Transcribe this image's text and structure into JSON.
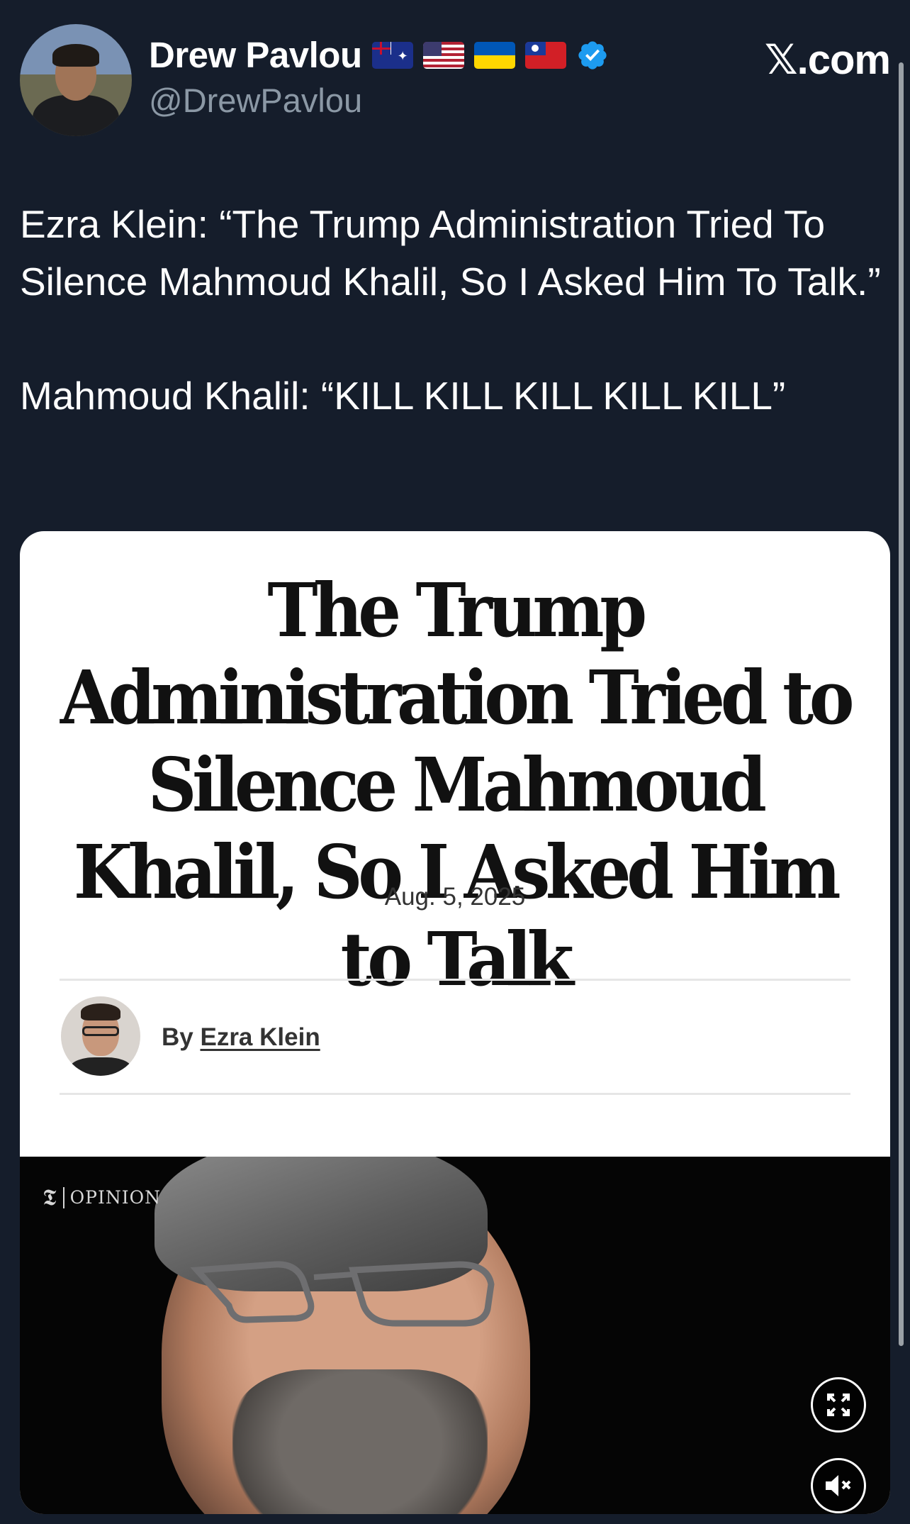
{
  "header": {
    "display_name": "Drew Pavlou",
    "handle": "@DrewPavlou",
    "flags": [
      "australia-flag-icon",
      "usa-flag-icon",
      "ukraine-flag-icon",
      "taiwan-flag-icon"
    ],
    "verified_icon": "verified-badge-icon",
    "site_label": "𝕏.com"
  },
  "tweet": {
    "line1": "Ezra Klein: “The Trump Administration Tried To Silence Mahmoud Khalil, So I Asked Him To Talk.”",
    "line2": "Mahmoud Khalil: “KILL KILL KILL KILL KILL”"
  },
  "card": {
    "headline": "The Trump Administration Tried to Silence Mahmoud Khalil, So I Asked Him to Talk",
    "date": "Aug. 5, 2025",
    "byline_prefix": "By ",
    "author": "Ezra Klein",
    "video": {
      "logo_text": "𝕿",
      "section_label": "OPINION",
      "fullscreen_icon": "fullscreen-icon",
      "mute_icon": "muted-speaker-icon"
    }
  },
  "colors": {
    "background": "#151d2b",
    "text": "#ffffff",
    "muted": "#8b98a5",
    "verified": "#1d9bf0"
  }
}
